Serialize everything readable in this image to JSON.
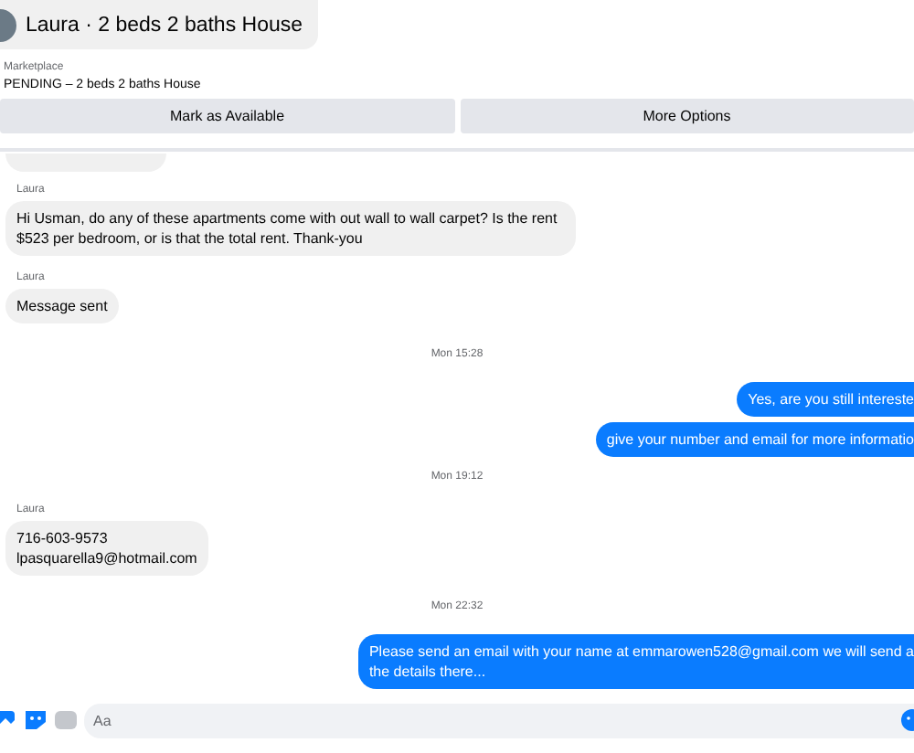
{
  "header": {
    "title": "Laura · 2 beds 2 baths House"
  },
  "listing": {
    "source": "Marketplace",
    "status": "PENDING – 2 beds 2 baths House",
    "buttons": [
      "Mark as Available",
      "More Options"
    ]
  },
  "messages": [
    {
      "kind": "incoming",
      "sender": "Laura",
      "lines": [
        "Hi Usman, do any of these apartments come with out wall to wall carpet? Is the rent $523 per bedroom, or is that the total rent. Thank-you"
      ]
    },
    {
      "kind": "incoming",
      "sender": "Laura",
      "lines": [
        "Message sent"
      ]
    },
    {
      "kind": "timestamp",
      "text": "Mon 15:28"
    },
    {
      "kind": "outgoing",
      "lines": [
        "Yes, are you still intereste"
      ]
    },
    {
      "kind": "outgoing",
      "lines": [
        "give your number and email for more informatio"
      ]
    },
    {
      "kind": "timestamp",
      "text": "Mon 19:12"
    },
    {
      "kind": "incoming",
      "sender": "Laura",
      "lines": [
        "716-603-9573",
        "lpasquarella9@hotmail.com"
      ]
    },
    {
      "kind": "timestamp",
      "text": "Mon 22:32"
    },
    {
      "kind": "outgoing",
      "lines": [
        "Please send an email with your name at emmarowen528@gmail.com we will send a",
        "the details there..."
      ]
    }
  ],
  "composer": {
    "placeholder": "Aa"
  }
}
